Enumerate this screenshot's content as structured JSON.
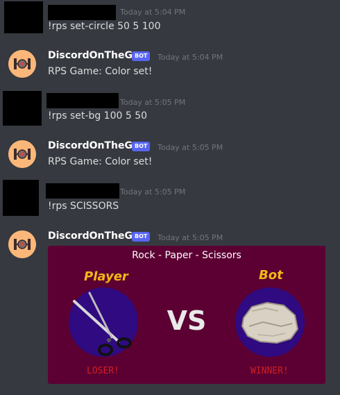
{
  "messages": [
    {
      "timestamp": "Today at 5:04 PM",
      "text": "!rps set-circle 50 5 100"
    },
    {
      "username": "DiscordOnTheGo",
      "tag": "BOT",
      "timestamp": "Today at 5:04 PM",
      "text": "RPS Game: Color set!"
    },
    {
      "timestamp": "Today at 5:05 PM",
      "text": "!rps set-bg 100 5 50"
    },
    {
      "username": "DiscordOnTheGo",
      "tag": "BOT",
      "timestamp": "Today at 5:05 PM",
      "text": "RPS Game: Color set!"
    },
    {
      "timestamp": "Today at 5:05 PM",
      "text": "!rps SCISSORS"
    },
    {
      "username": "DiscordOnTheGo",
      "tag": "BOT",
      "timestamp": "Today at 5:05 PM"
    }
  ],
  "game": {
    "title": "Rock - Paper - Scissors",
    "player_label": "Player",
    "bot_label": "Bot",
    "vs": "VS",
    "player_result": "LOSER!",
    "bot_result": "WINNER!",
    "player_choice_icon": "scissors-icon",
    "bot_choice_icon": "rock-icon"
  },
  "colors": {
    "background": "#36393f",
    "card_background": "#5c0033",
    "circle": "#2f0a80",
    "label": "#f5b716",
    "result": "#d51e1e",
    "bot_tag": "#5865f2"
  }
}
